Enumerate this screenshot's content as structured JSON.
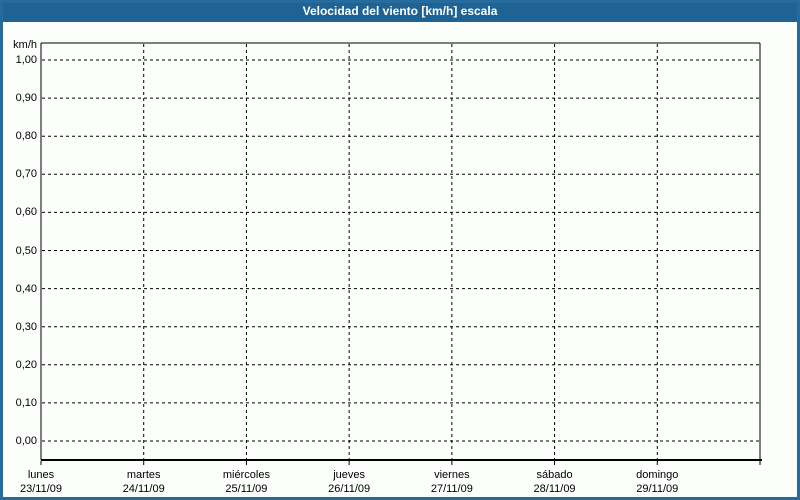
{
  "window": {
    "title": "Velocidad del viento [km/h] escala"
  },
  "colors": {
    "titlebar_bg": "#1e6394",
    "titlebar_text": "#ffffff",
    "frame_border": "#276b9c",
    "background": "#fcfefc",
    "grid": "#000000",
    "text": "#000000"
  },
  "chart_data": {
    "type": "line",
    "title": "Velocidad del viento [km/h] escala",
    "ylabel": "km/h",
    "y_ticks": [
      "1,00",
      "0,90",
      "0,80",
      "0,70",
      "0,60",
      "0,50",
      "0,40",
      "0,30",
      "0,20",
      "0,10",
      "0,00"
    ],
    "ylim": [
      0.0,
      1.05
    ],
    "grid": true,
    "legend_position": "none",
    "x_categories": [
      {
        "day": "lunes",
        "date": "23/11/09"
      },
      {
        "day": "martes",
        "date": "24/11/09"
      },
      {
        "day": "miércoles",
        "date": "25/11/09"
      },
      {
        "day": "jueves",
        "date": "26/11/09"
      },
      {
        "day": "viernes",
        "date": "27/11/09"
      },
      {
        "day": "sábado",
        "date": "28/11/09"
      },
      {
        "day": "domingo",
        "date": "29/11/09"
      }
    ],
    "series": []
  }
}
